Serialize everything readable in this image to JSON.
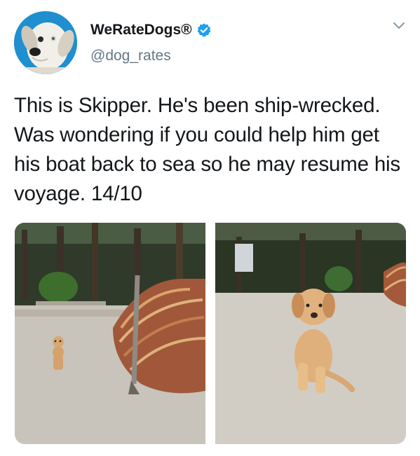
{
  "user": {
    "display_name": "WeRateDogs®",
    "handle": "@dog_rates",
    "verified": true,
    "avatar_icon": "dog-avatar-icon",
    "verified_color": "#1da1f2"
  },
  "tweet": {
    "text": "This is Skipper. He's been ship-wrecked. Was wondering if you could help him get his boat back to sea so he may resume his voyage. 14/10"
  },
  "media": {
    "photos": [
      {
        "icon": "puppy-with-boat-photo"
      },
      {
        "icon": "puppy-sitting-photo"
      }
    ]
  },
  "menu": {
    "icon": "chevron-down-icon"
  }
}
